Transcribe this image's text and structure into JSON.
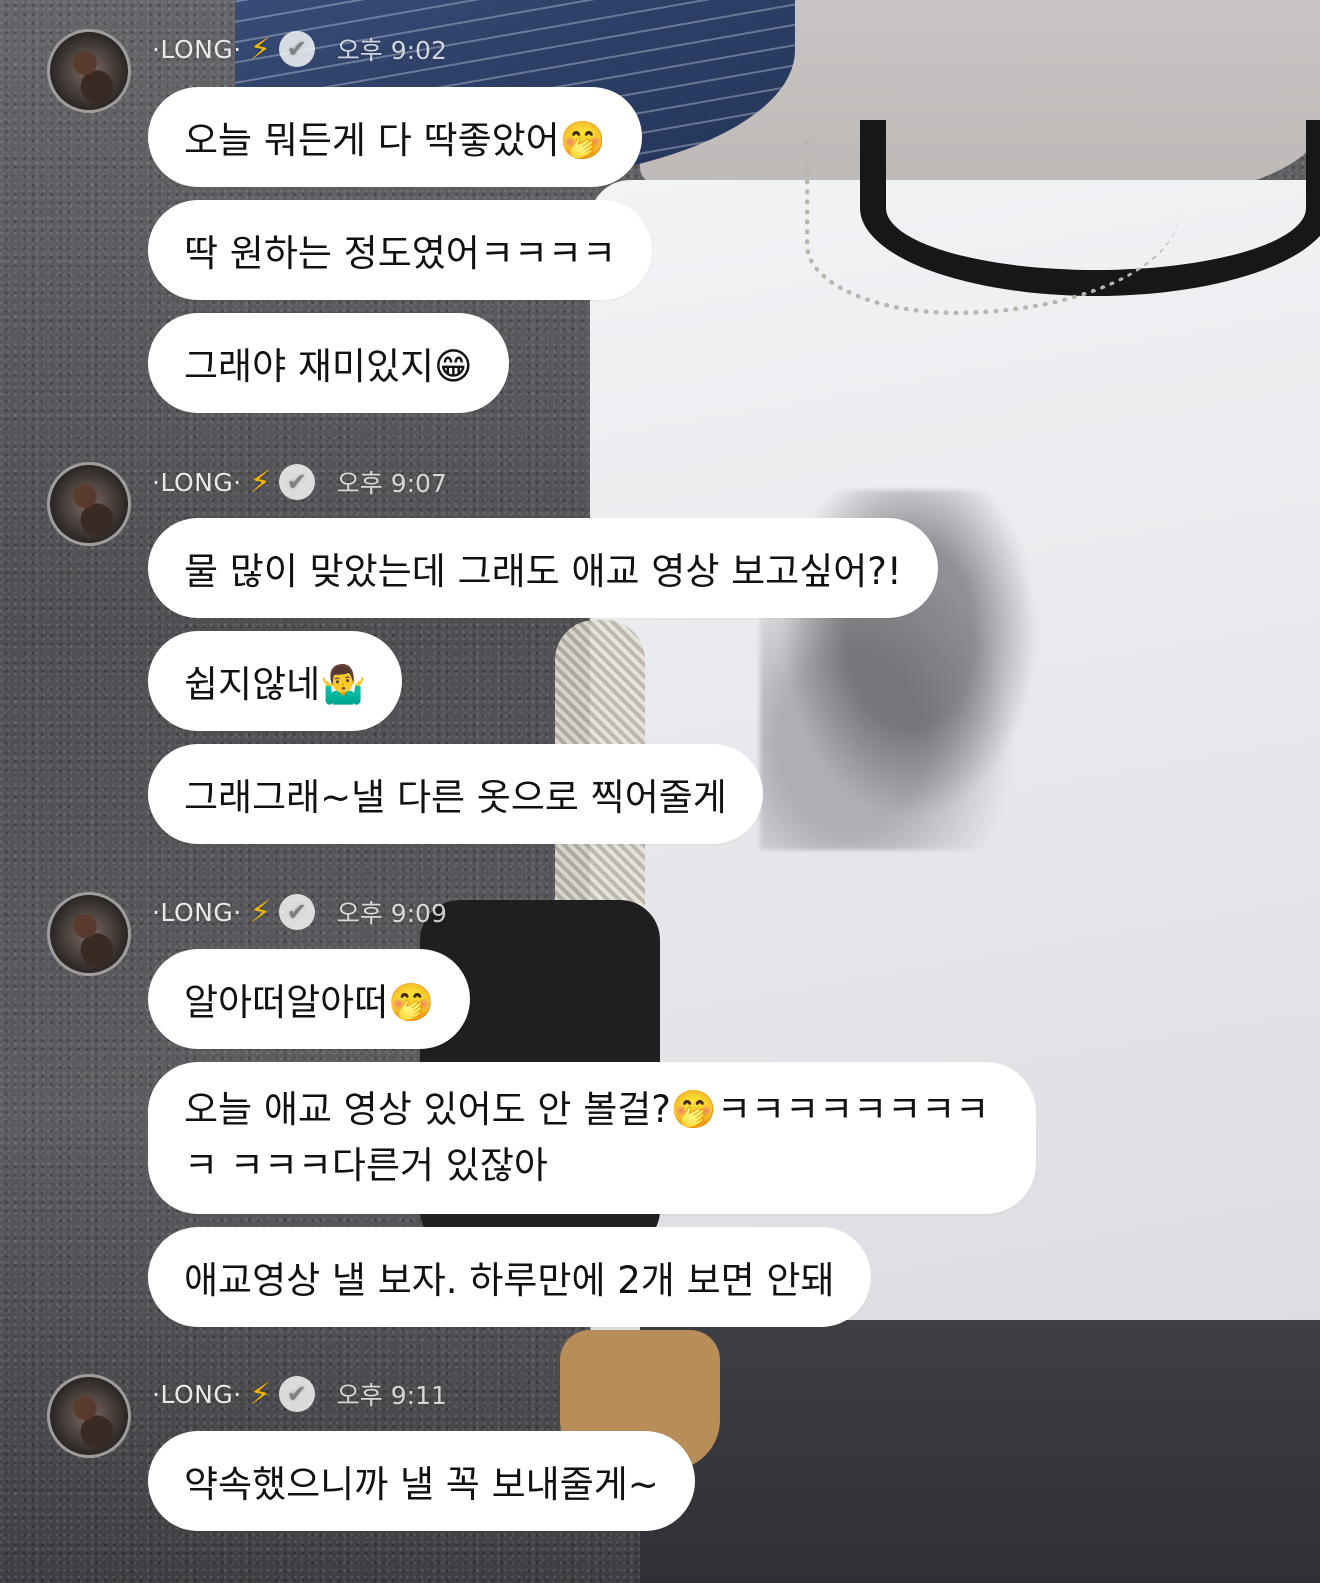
{
  "sender": {
    "name": "·LONG·",
    "bolt_icon": "⚡",
    "verified_icon": "✔"
  },
  "groups": [
    {
      "time": "오후 9:02",
      "messages": [
        {
          "text": "오늘 뭐든게 다 딱좋았어🤭"
        },
        {
          "text": "딱 원하는 정도였어ㅋㅋㅋㅋ"
        },
        {
          "text": "그래야 재미있지😁"
        }
      ]
    },
    {
      "time": "오후 9:07",
      "messages": [
        {
          "text": "물 많이 맞았는데 그래도 애교 영상 보고싶어?!"
        },
        {
          "text": "쉽지않네🤷‍♂️"
        },
        {
          "text": "그래그래~낼 다른 옷으로 찍어줄게"
        }
      ]
    },
    {
      "time": "오후 9:09",
      "messages": [
        {
          "text": "알아떠알아떠🤭"
        },
        {
          "text": "오늘 애교 영상 있어도 안 볼걸?🤭ㅋㅋㅋㅋㅋㅋㅋㅋㅋ ㅋㅋㅋ다른거 있잖아"
        },
        {
          "text": "애교영상 낼 보자. 하루만에 2개 보면 안돼"
        }
      ]
    },
    {
      "time": "오후 9:11",
      "messages": [
        {
          "text": "약속했으니까 낼 꼭 보내줄게~"
        }
      ]
    }
  ]
}
